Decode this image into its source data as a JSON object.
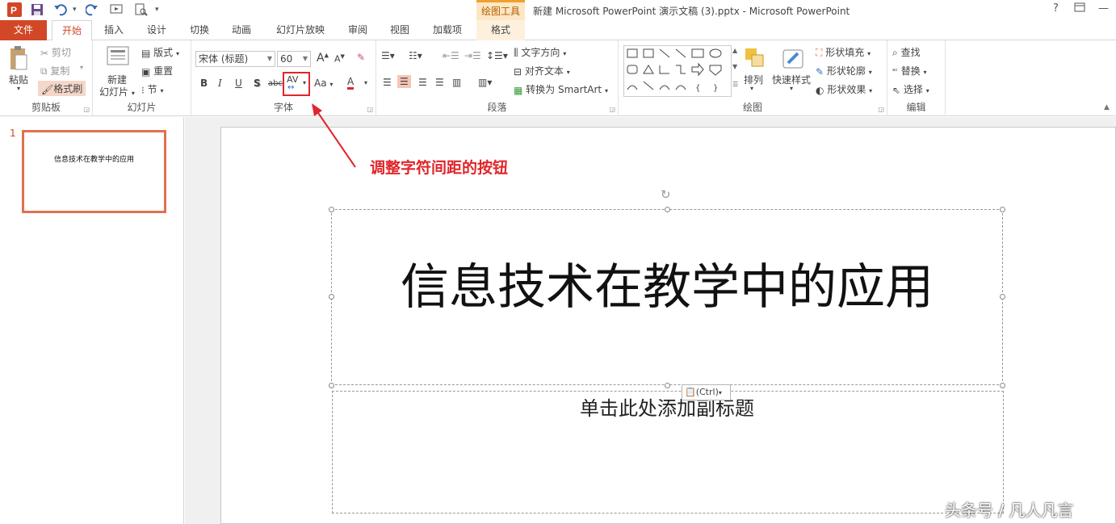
{
  "window": {
    "title": "新建 Microsoft PowerPoint 演示文稿 (3).pptx - Microsoft PowerPoint",
    "help": "?",
    "ctx_group": "绘图工具"
  },
  "tabs": [
    "文件",
    "开始",
    "插入",
    "设计",
    "切换",
    "动画",
    "幻灯片放映",
    "审阅",
    "视图",
    "加载项"
  ],
  "ctx_tab": "格式",
  "clipboard": {
    "paste": "粘贴",
    "cut": "剪切",
    "copy": "复制",
    "painter": "格式刷",
    "label": "剪贴板"
  },
  "slides_group": {
    "new": "新建",
    "new2": "幻灯片",
    "layout": "版式",
    "reset": "重置",
    "section": "节",
    "label": "幻灯片"
  },
  "font": {
    "name": "宋体 (标题)",
    "size": "60",
    "label": "字体",
    "bold": "B",
    "italic": "I",
    "underline": "U",
    "shadow": "S",
    "strike": "abc",
    "spacing": "AV",
    "case": "Aa",
    "color": "A"
  },
  "paragraph": {
    "direction": "文字方向",
    "align": "对齐文本",
    "smartart": "转换为 SmartArt",
    "label": "段落"
  },
  "drawing": {
    "arrange": "排列",
    "quick": "快速样式",
    "fill": "形状填充",
    "outline": "形状轮廓",
    "effects": "形状效果",
    "label": "绘图"
  },
  "editing": {
    "find": "查找",
    "replace": "替换",
    "select": "选择",
    "label": "编辑"
  },
  "thumbnail": {
    "number": "1",
    "text": "信息技术在教学中的应用"
  },
  "slide": {
    "title": "信息技术在教学中的应用",
    "subtitle": "单击此处添加副标题",
    "paste_opts": "(Ctrl)"
  },
  "annotation": "调整字符间距的按钮",
  "watermark": "头条号 / 凡人凡言",
  "colors": {
    "accent": "#d24726",
    "highlight": "#e0262b",
    "thumb_border": "#e0714f"
  }
}
